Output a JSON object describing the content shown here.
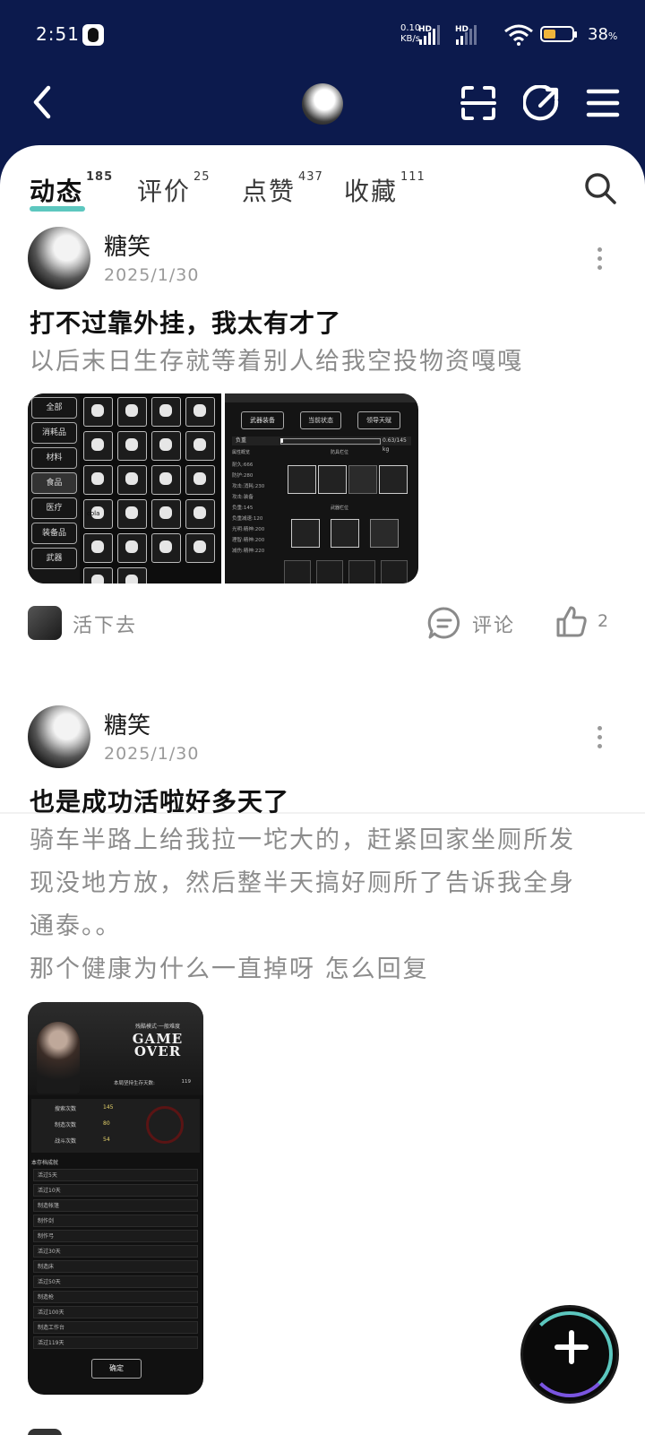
{
  "status_bar": {
    "time": "2:51",
    "net_speed_value": "0.10",
    "net_speed_unit": "KB/s",
    "sim1_label": "HD",
    "sim2_label": "HD",
    "battery_percent": "38",
    "battery_level": 0.38
  },
  "tabs": [
    {
      "label": "动态",
      "count": "185",
      "active": true
    },
    {
      "label": "评价",
      "count": "25",
      "active": false
    },
    {
      "label": "点赞",
      "count": "437",
      "active": false
    },
    {
      "label": "收藏",
      "count": "111",
      "active": false
    }
  ],
  "posts": [
    {
      "author": "糖笑",
      "date": "2025/1/30",
      "title": "打不过靠外挂，我太有才了",
      "body": [
        "以后末日生存就等着别人给我空投物资嘎嘎"
      ],
      "game_name": "活下去",
      "comment_label": "评论",
      "like_count": "2",
      "image1": {
        "menu": [
          "全部",
          "消耗品",
          "材料",
          "食品",
          "医疗",
          "装备品",
          "武器"
        ],
        "tags": [
          "cola"
        ]
      },
      "image2": {
        "buttons": [
          "武器装备",
          "当前状态",
          "领导天赋"
        ],
        "weight_label": "负重",
        "weight_value": "0.63/145 kg",
        "weight_fraction": 0.0043,
        "section_attrs": "属性概览",
        "section_armor": "防具栏位",
        "section_weapon": "武器栏位",
        "stats": [
          "耐久:666",
          "防护:280",
          "攻击:消耗:230",
          "攻击:装备",
          "负重:145",
          "负重减速:120",
          "光明:精神:200",
          "理智:精神:200",
          "减伤:精神:220"
        ]
      }
    },
    {
      "author": "糖笑",
      "date": "2025/1/30",
      "title": "也是成功活啦好多天了",
      "body": [
        "骑车半路上给我拉一坨大的，赶紧回家坐厕所发",
        "现没地方放，然后整半天搞好厕所了告诉我全身",
        "通泰。。",
        "那个健康为什么一直掉呀 怎么回复"
      ],
      "image": {
        "mode_label": "残酷模式·一般难度",
        "game_over_line1": "GAME",
        "game_over_line2": "OVER",
        "survived_label": "本局坚持生存天数:",
        "survived_days": "119",
        "stats": [
          {
            "label": "搜索次数",
            "value": "145"
          },
          {
            "label": "制造次数",
            "value": "80"
          },
          {
            "label": "战斗次数",
            "value": "54"
          }
        ],
        "achievements_title": "本存档成就",
        "achievements": [
          "活过5天",
          "活过10天",
          "制造帐篷",
          "制作剑",
          "制作弓",
          "活过30天",
          "制造床",
          "活过50天",
          "制造枪",
          "活过100天",
          "制造工作台",
          "活过119天"
        ],
        "confirm_label": "确定"
      }
    }
  ]
}
